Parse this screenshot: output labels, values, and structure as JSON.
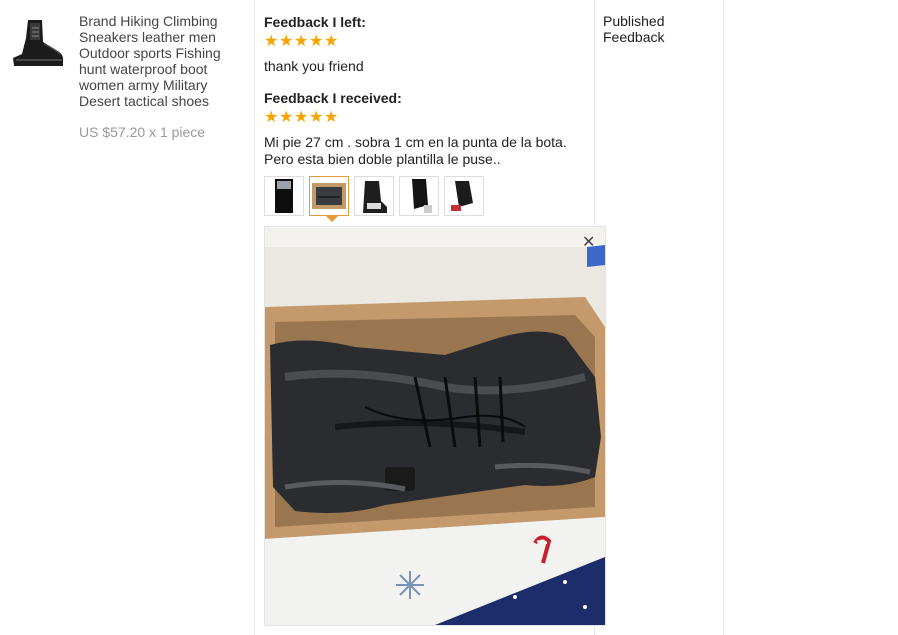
{
  "product": {
    "title": "Brand Hiking Climbing Sneakers leather men Outdoor sports Fishing hunt waterproof boot women army Military Desert tactical shoes",
    "price": "US $57.20 x 1 piece"
  },
  "feedback_left": {
    "heading": "Feedback I left:",
    "rating": 5,
    "text": "thank you friend"
  },
  "feedback_received": {
    "heading": "Feedback I received:",
    "rating": 5,
    "text_line1": "Mi pie 27 cm . sobra 1 cm en la punta de la bota.",
    "text_line2": "Pero esta bien doble plantilla le puse..",
    "photo_count": 5,
    "selected_photo": 2
  },
  "viewer": {
    "close_icon": "close-icon"
  },
  "status": {
    "line1": "Published",
    "line2": "Feedback"
  },
  "colors": {
    "star": "#f7a400",
    "active_border": "#e79a3a"
  }
}
